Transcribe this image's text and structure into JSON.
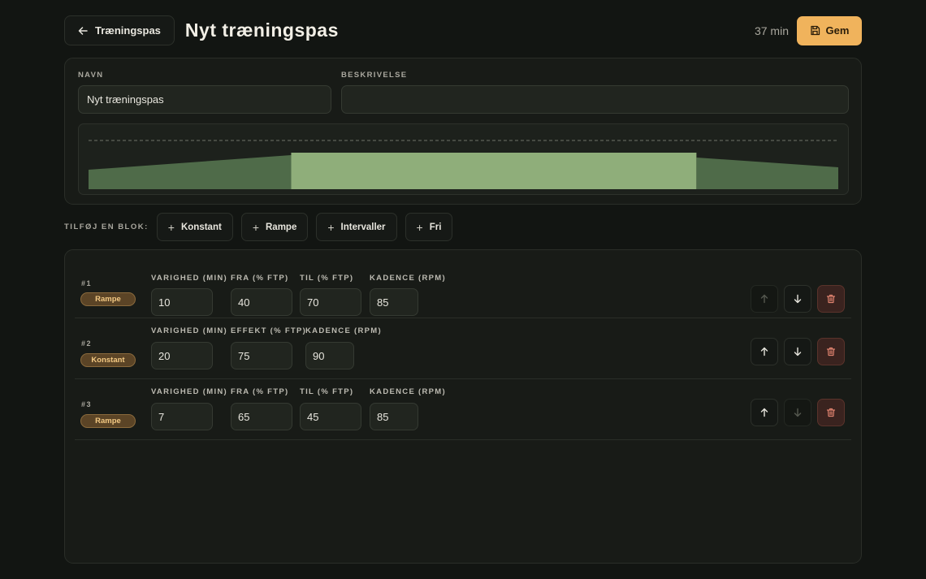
{
  "header": {
    "back_label": "Træningspas",
    "title": "Nyt træningspas",
    "duration": "37 min",
    "save_label": "Gem"
  },
  "form": {
    "name_label": "NAVN",
    "name_value": "Nyt træningspas",
    "description_label": "BESKRIVELSE",
    "description_value": ""
  },
  "profile_chart": {
    "type": "area",
    "x_unit": "min",
    "y_unit": "% FTP",
    "reference_line": 100,
    "segments": [
      {
        "start": 0,
        "end": 10,
        "from": 40,
        "to": 70
      },
      {
        "start": 10,
        "end": 30,
        "from": 75,
        "to": 75
      },
      {
        "start": 30,
        "end": 37,
        "from": 65,
        "to": 45
      }
    ],
    "colors": {
      "ramp": "#4f6b49",
      "constant": "#8fae7a",
      "reference": "#6e7268"
    }
  },
  "add_block": {
    "label": "TILFØJ EN BLOK:",
    "buttons": [
      "Konstant",
      "Rampe",
      "Intervaller",
      "Fri"
    ]
  },
  "blocks": [
    {
      "num": "#1",
      "type": "Rampe",
      "labels": [
        "VARIGHED (MIN)",
        "FRA (% FTP)",
        "TIL (% FTP)",
        "KADENCE (RPM)"
      ],
      "values": [
        "10",
        "40",
        "70",
        "85"
      ],
      "up_enabled": false,
      "down_enabled": true
    },
    {
      "num": "#2",
      "type": "Konstant",
      "labels": [
        "VARIGHED (MIN)",
        "EFFEKT (% FTP)",
        "KADENCE (RPM)"
      ],
      "values": [
        "20",
        "75",
        "90"
      ],
      "up_enabled": true,
      "down_enabled": true
    },
    {
      "num": "#3",
      "type": "Rampe",
      "labels": [
        "VARIGHED (MIN)",
        "FRA (% FTP)",
        "TIL (% FTP)",
        "KADENCE (RPM)"
      ],
      "values": [
        "7",
        "65",
        "45",
        "85"
      ],
      "up_enabled": true,
      "down_enabled": false
    }
  ],
  "colors": {
    "accent": "#f0b35c",
    "badge_bg": "#5b4426",
    "badge_text": "#f3c983",
    "delete_bg": "#3a231f",
    "delete_icon": "#e0836f"
  }
}
